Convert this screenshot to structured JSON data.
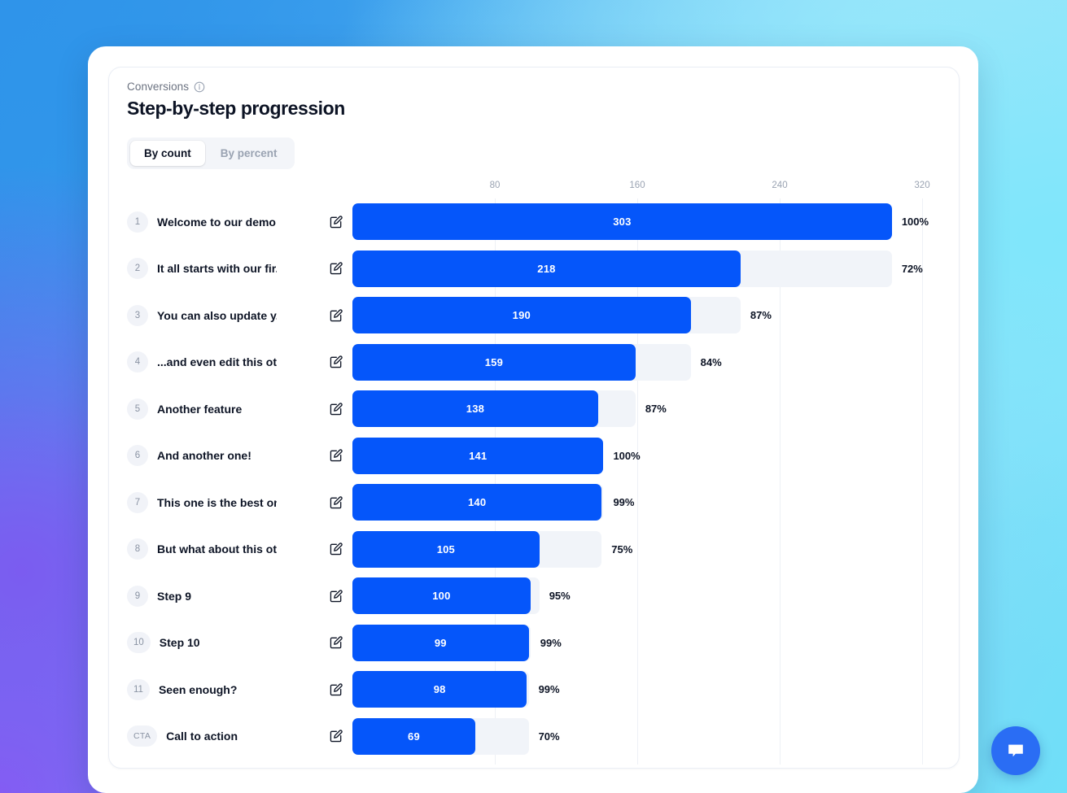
{
  "header": {
    "eyebrow": "Conversions",
    "info_icon": "info-icon",
    "title": "Step-by-step progression"
  },
  "toggle": {
    "options": [
      {
        "label": "By count",
        "active": true
      },
      {
        "label": "By percent",
        "active": false
      }
    ]
  },
  "chat": {
    "icon": "chat-bubble-icon"
  },
  "colors": {
    "bar_fill": "#0556fa",
    "bar_track": "#f1f4f9",
    "accent": "#2a6df4",
    "text": "#0d1425",
    "muted": "#9aa3b2"
  },
  "chart_data": {
    "type": "bar",
    "orientation": "horizontal",
    "title": "Step-by-step progression",
    "subtitle": "Conversions",
    "xlabel": "",
    "ylabel": "",
    "xlim": [
      0,
      320
    ],
    "ticks": [
      80,
      160,
      240,
      320
    ],
    "grid": true,
    "legend": "none",
    "value_mode": "By count",
    "categories": [
      "Welcome to our demo ...",
      "It all starts with our fir...",
      "You can also update y...",
      "...and even edit this ot...",
      "Another feature",
      "And another one!",
      "This one is the best on...",
      "But what about this ot...",
      "Step 9",
      "Step 10",
      "Seen enough?",
      "Call to action"
    ],
    "values": [
      303,
      218,
      190,
      159,
      138,
      141,
      140,
      105,
      100,
      99,
      98,
      69
    ],
    "percents": [
      "100%",
      "72%",
      "87%",
      "84%",
      "87%",
      "100%",
      "99%",
      "99%",
      "95%",
      "99%",
      "99%",
      "70%"
    ],
    "rows": [
      {
        "badge": "1",
        "name": "Welcome to our demo ...",
        "value": 303,
        "value_label": "303",
        "percent": "100%",
        "track": 303,
        "edit_icon": "edit-icon"
      },
      {
        "badge": "2",
        "name": "It all starts with our fir...",
        "value": 218,
        "value_label": "218",
        "percent": "72%",
        "track": 303,
        "edit_icon": "edit-icon"
      },
      {
        "badge": "3",
        "name": "You can also update y...",
        "value": 190,
        "value_label": "190",
        "percent": "87%",
        "track": 218,
        "edit_icon": "edit-icon"
      },
      {
        "badge": "4",
        "name": "...and even edit this ot...",
        "value": 159,
        "value_label": "159",
        "percent": "84%",
        "track": 190,
        "edit_icon": "edit-icon"
      },
      {
        "badge": "5",
        "name": "Another feature",
        "value": 138,
        "value_label": "138",
        "percent": "87%",
        "track": 159,
        "edit_icon": "edit-icon"
      },
      {
        "badge": "6",
        "name": "And another one!",
        "value": 141,
        "value_label": "141",
        "percent": "100%",
        "track": 141,
        "edit_icon": "edit-icon"
      },
      {
        "badge": "7",
        "name": "This one is the best on...",
        "value": 140,
        "value_label": "140",
        "percent": "99%",
        "track": 141,
        "edit_icon": "edit-icon"
      },
      {
        "badge": "8",
        "name": "But what about this ot...",
        "value": 105,
        "value_label": "105",
        "percent": "75%",
        "track": 140,
        "edit_icon": "edit-icon"
      },
      {
        "badge": "9",
        "name": "Step 9",
        "value": 100,
        "value_label": "100",
        "percent": "95%",
        "track": 105,
        "edit_icon": "edit-icon"
      },
      {
        "badge": "10",
        "name": "Step 10",
        "value": 99,
        "value_label": "99",
        "percent": "99%",
        "track": 100,
        "edit_icon": "edit-icon"
      },
      {
        "badge": "11",
        "name": "Seen enough?",
        "value": 98,
        "value_label": "98",
        "percent": "99%",
        "track": 99,
        "edit_icon": "edit-icon"
      },
      {
        "badge": "CTA",
        "name": "Call to action",
        "value": 69,
        "value_label": "69",
        "percent": "70%",
        "track": 99,
        "edit_icon": "edit-icon"
      }
    ]
  }
}
